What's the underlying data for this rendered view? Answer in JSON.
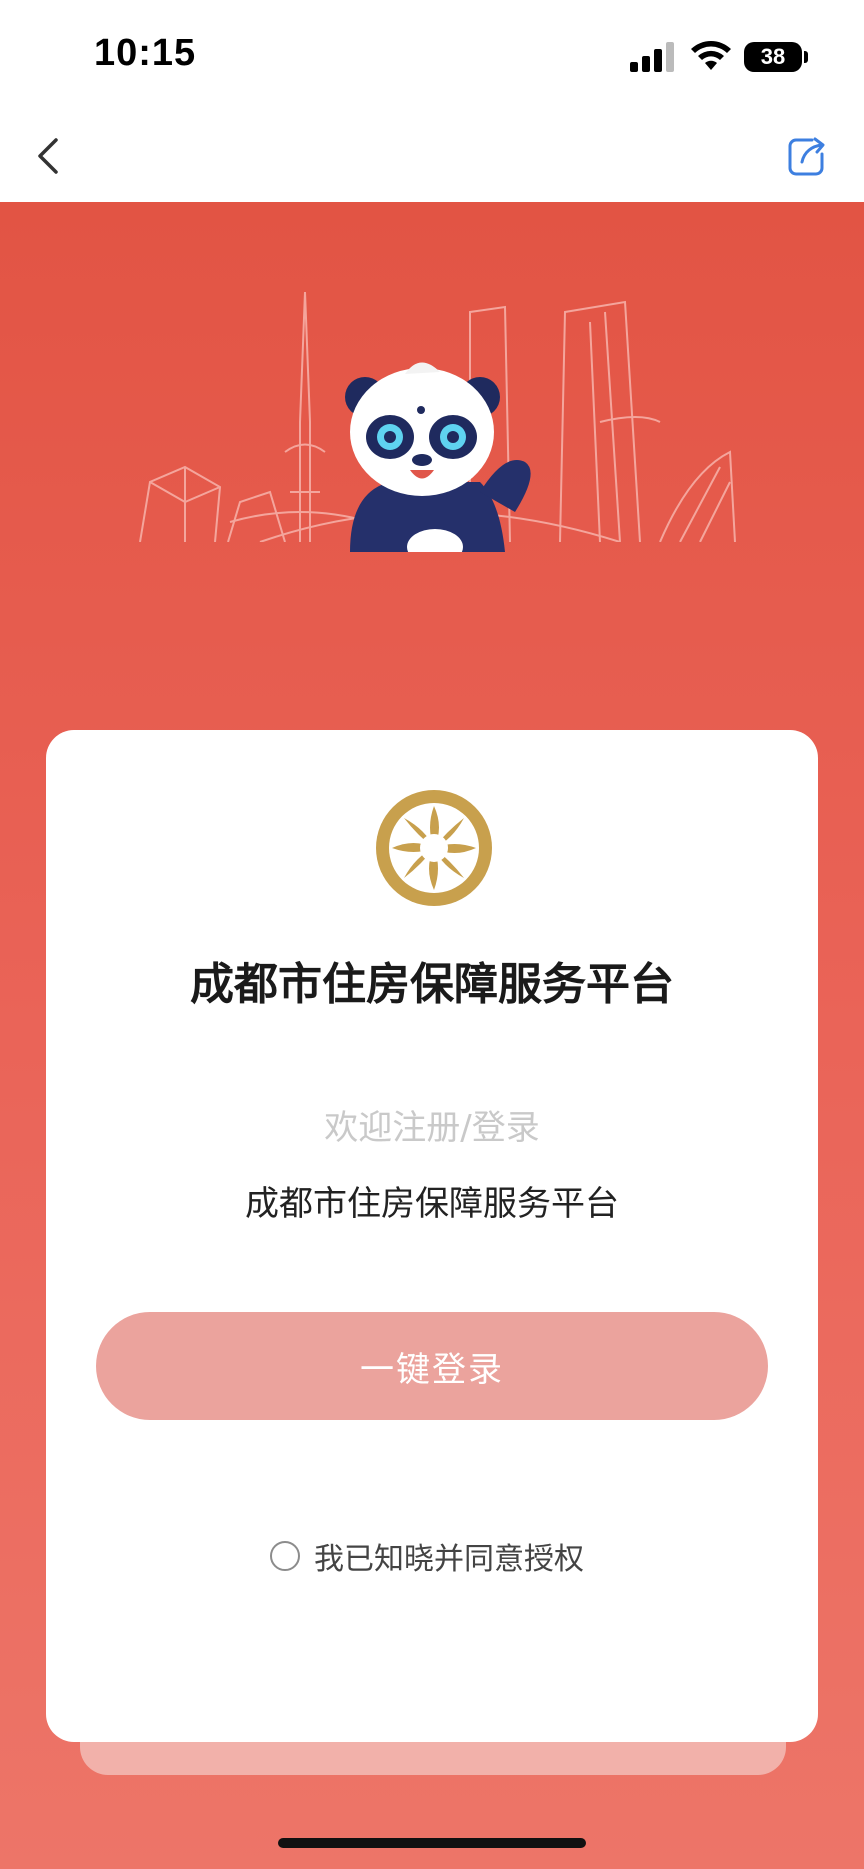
{
  "status_bar": {
    "time": "10:15",
    "battery": "38",
    "icons": [
      "signal-icon",
      "wifi-icon",
      "battery-icon"
    ]
  },
  "nav": {
    "back_icon": "chevron-left-icon",
    "share_icon": "share-icon"
  },
  "card": {
    "emblem_icon": "gold-sunbird-emblem",
    "title": "成都市住房保障服务平台",
    "welcome": "欢迎注册/登录",
    "platform_name": "成都市住房保障服务平台",
    "login_button": "一键登录",
    "agreement_label": "我已知晓并同意授权",
    "agreement_checked": false
  },
  "colors": {
    "hero_top": "#e25444",
    "hero_bottom": "#ed7568",
    "button": "#eba39d",
    "emblem_gold": "#c8a04d"
  }
}
